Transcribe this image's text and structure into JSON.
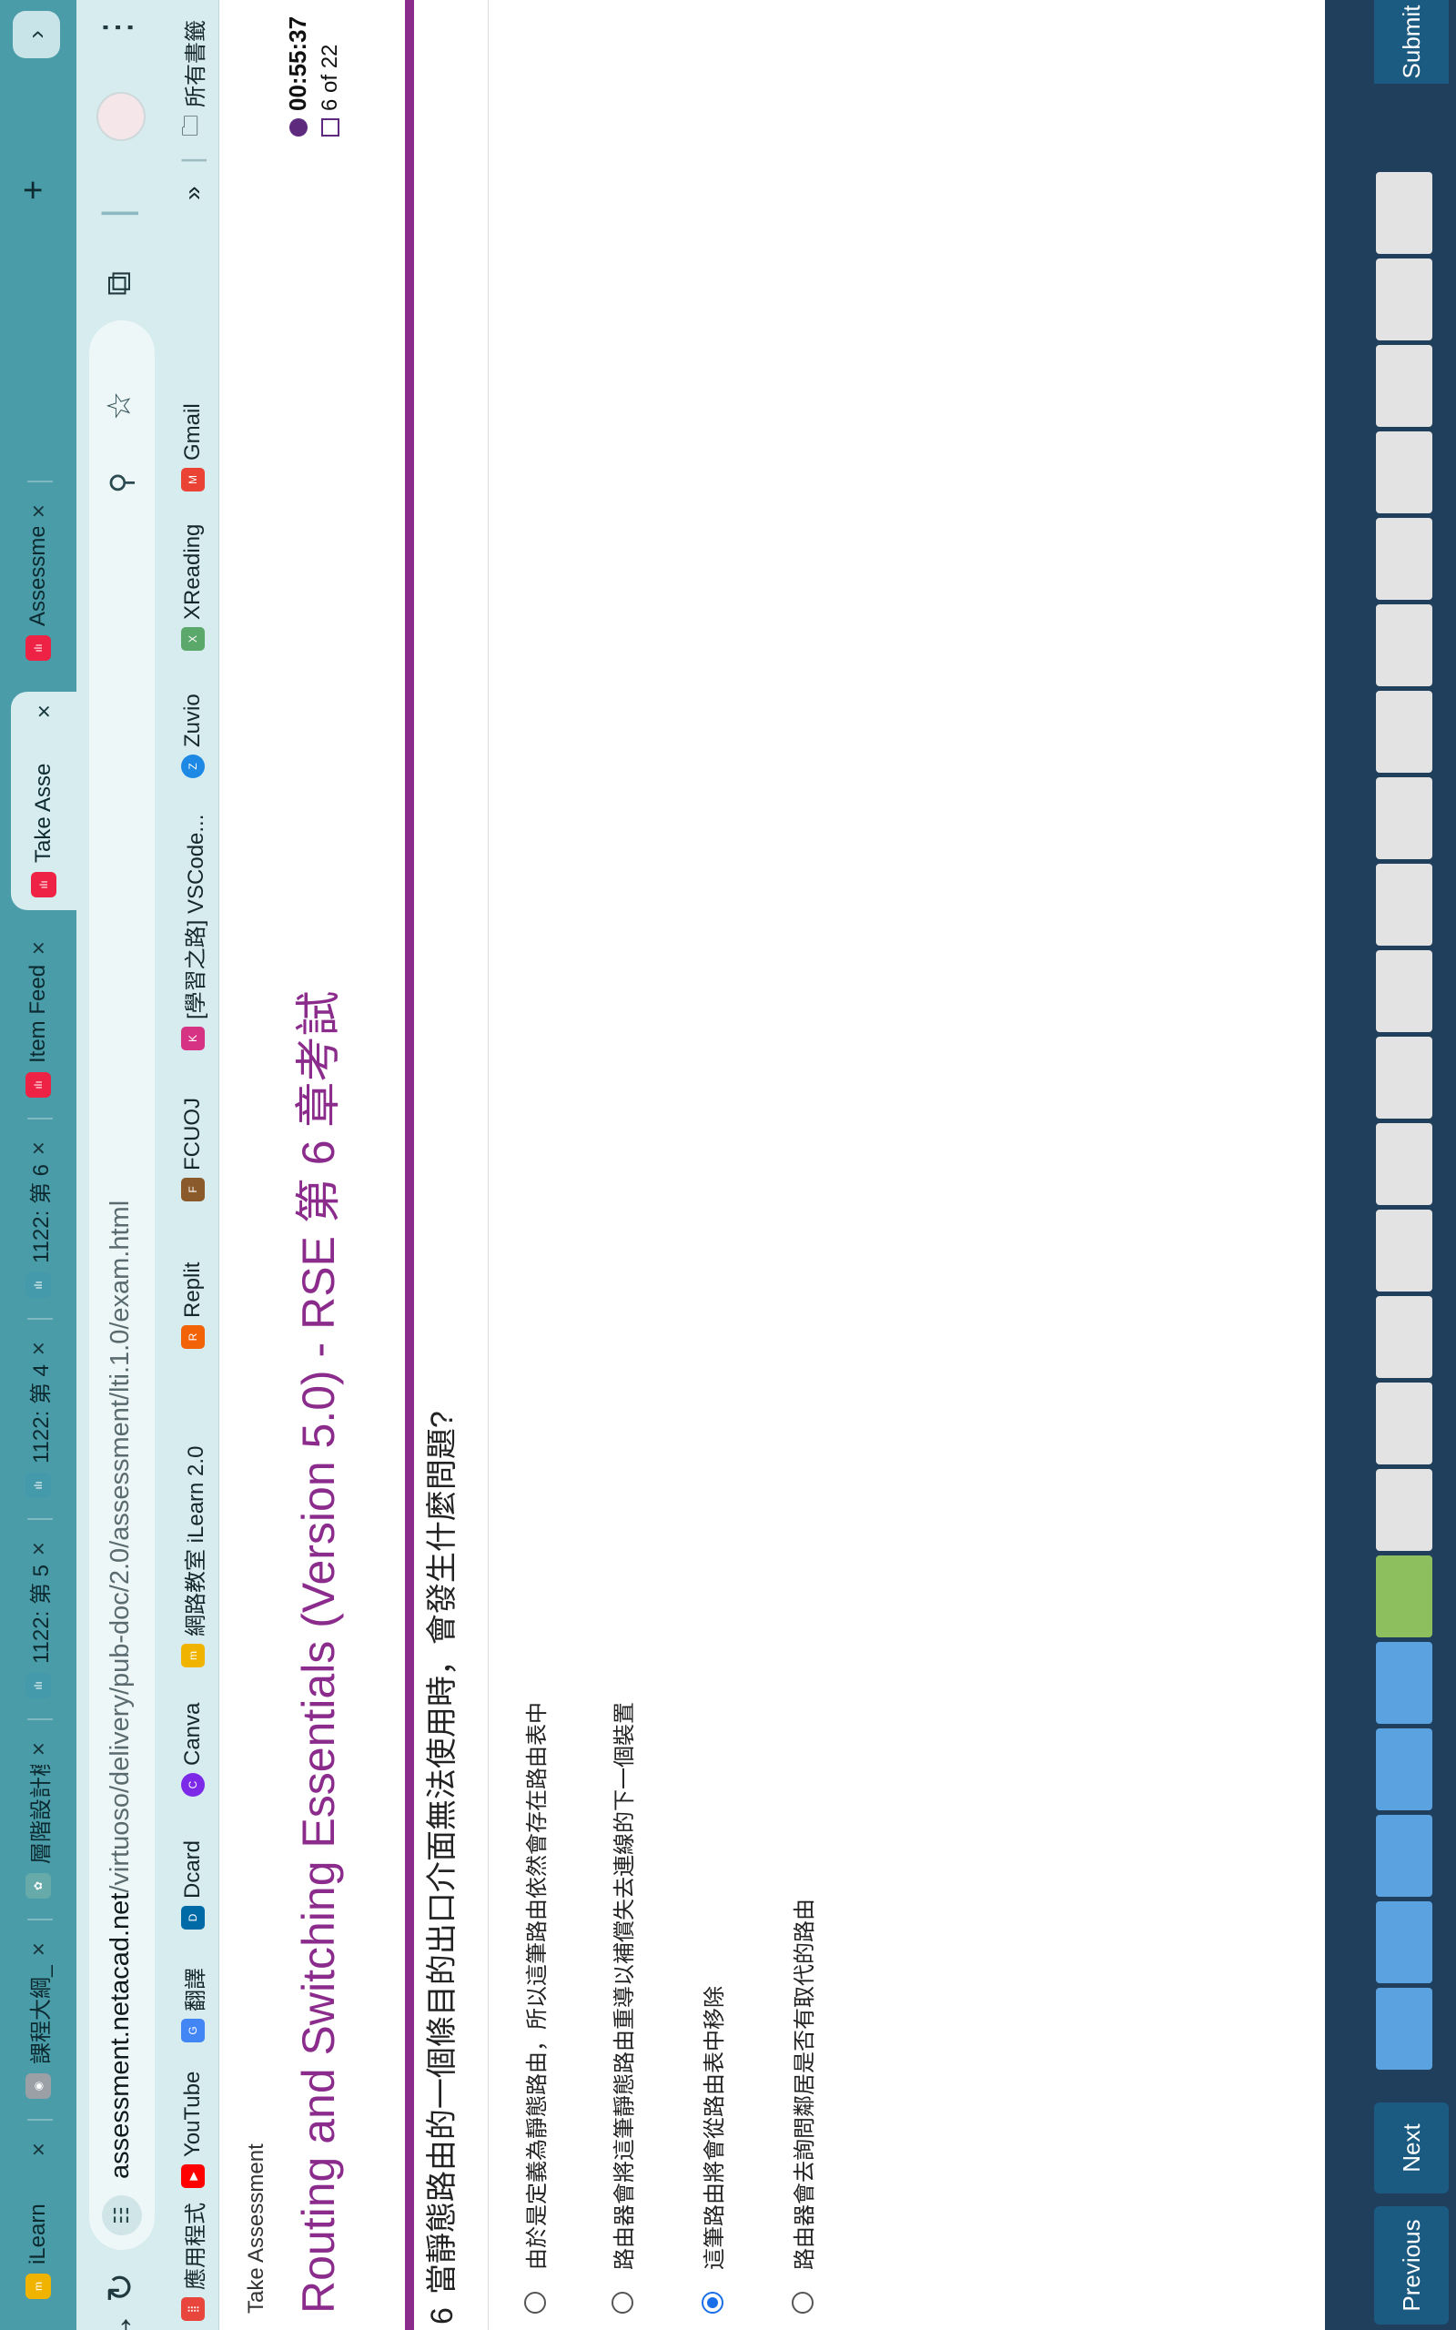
{
  "tabs": [
    {
      "title": "iLearn",
      "fav_color": "#f0b400",
      "fav_glyph": "m"
    },
    {
      "title": "課程大綱_r",
      "fav_color": "#9aa0a6",
      "fav_glyph": "◉"
    },
    {
      "title": "層階設計模",
      "fav_color": "#6aa",
      "fav_glyph": "✿"
    },
    {
      "title": "1122: 第 5",
      "fav_color": "#49a",
      "fav_glyph": "cisco"
    },
    {
      "title": "1122: 第 4",
      "fav_color": "#49a",
      "fav_glyph": "cisco"
    },
    {
      "title": "1122: 第 6",
      "fav_color": "#49a",
      "fav_glyph": "cisco"
    },
    {
      "title": "Item Feed",
      "fav_color": "#e24",
      "fav_glyph": "cisco"
    },
    {
      "title": "Take Asse",
      "fav_color": "#e24",
      "fav_glyph": "cisco"
    },
    {
      "title": "Assessme",
      "fav_color": "#e24",
      "fav_glyph": "cisco"
    }
  ],
  "url": {
    "host": "assessment.netacad.net",
    "path": "/virtuoso/delivery/pub-doc/2.0/assessment/lti.1.0/exam.html"
  },
  "bookmarks": [
    {
      "label": "應用程式",
      "color": "#e8453c",
      "glyph": "⣿"
    },
    {
      "label": "YouTube",
      "color": "#ff0000",
      "glyph": "▶"
    },
    {
      "label": "翻譯",
      "color": "#4285f4",
      "glyph": "G"
    },
    {
      "label": "Dcard",
      "color": "#006aa6",
      "glyph": "D"
    },
    {
      "label": "Canva",
      "color": "#7d2ae8",
      "glyph": "C"
    },
    {
      "label": "網路教室 iLearn 2.0",
      "color": "#f0b400",
      "glyph": "m"
    },
    {
      "label": "Replit",
      "color": "#f26207",
      "glyph": "R"
    },
    {
      "label": "FCUOJ",
      "color": "#8a5a2a",
      "glyph": "F"
    },
    {
      "label": "[學習之路] VSCode...",
      "color": "#d63384",
      "glyph": "K"
    },
    {
      "label": "Zuvio",
      "color": "#1e88e5",
      "glyph": "Z"
    },
    {
      "label": "XReading",
      "color": "#5aa86a",
      "glyph": "X"
    },
    {
      "label": "Gmail",
      "color": "#ea4335",
      "glyph": "M"
    }
  ],
  "bookmarks_overflow": "»",
  "all_bookmarks": "所有書籤",
  "page": {
    "breadcrumb": "Take Assessment",
    "title": "Routing and Switching Essentials (Version 5.0) - RSE 第 6 章考試",
    "timer": "00:55:37",
    "count": "6 of 22"
  },
  "question": {
    "number": "6",
    "text": "當靜態路由的一個條目的出口介面無法使用時，會發生什麼問題?",
    "options": [
      {
        "text": "由於是定義為靜態路由，所以這筆路由依然會存在路由表中",
        "checked": false
      },
      {
        "text": "路由器會將這筆靜態路由重導以補償失去連線的下一個裝置",
        "checked": false
      },
      {
        "text": "這筆路由將會從路由表中移除",
        "checked": true
      },
      {
        "text": "路由器會去詢問鄰居是否有取代的路由",
        "checked": false
      }
    ]
  },
  "footer": {
    "previous": "Previous",
    "next": "Next",
    "submit": "Submit",
    "question_states": [
      "answered",
      "answered",
      "answered",
      "answered",
      "answered",
      "current",
      "unanswered",
      "unanswered",
      "unanswered",
      "unanswered",
      "unanswered",
      "unanswered",
      "unanswered",
      "unanswered",
      "unanswered",
      "unanswered",
      "unanswered",
      "unanswered",
      "unanswered",
      "unanswered",
      "unanswered",
      "unanswered"
    ],
    "colors": {
      "answered": "#5ba3e0",
      "current": "#8dbf5f",
      "unanswered": "#e3e3e3"
    }
  }
}
